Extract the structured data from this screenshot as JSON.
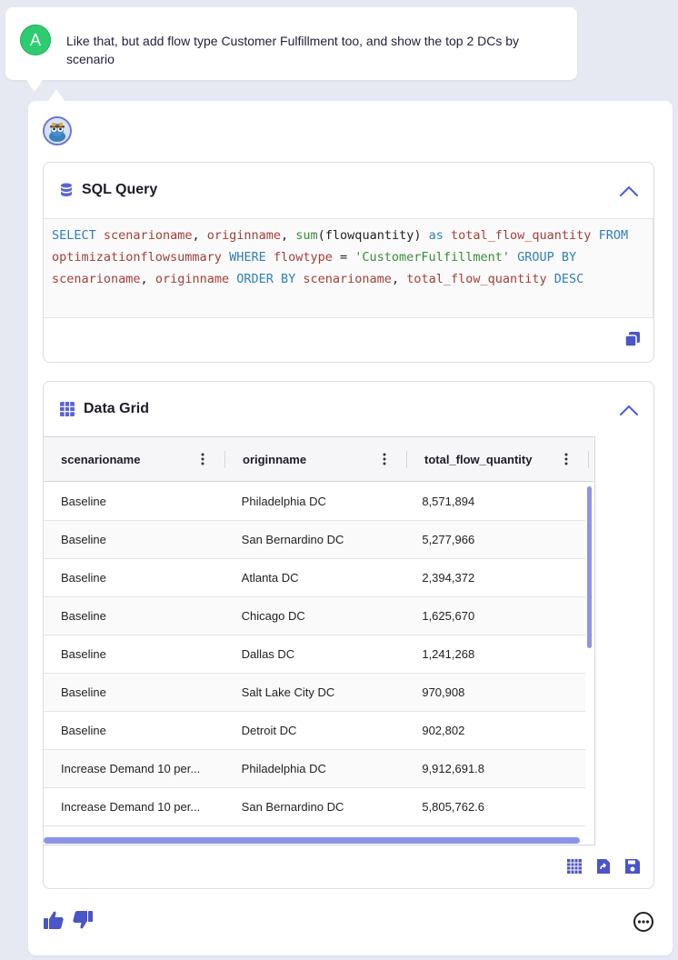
{
  "user_message": {
    "avatar_letter": "A",
    "text": "Like that, but add flow type Customer Fulfillment too, and show the top 2 DCs by scenario"
  },
  "sql_panel": {
    "title": "SQL Query",
    "query_tokens": [
      {
        "t": "SELECT",
        "c": "kw"
      },
      {
        "t": " "
      },
      {
        "t": "scenarioname",
        "c": "fn"
      },
      {
        "t": ", "
      },
      {
        "t": "originname",
        "c": "fn"
      },
      {
        "t": ", "
      },
      {
        "t": "sum",
        "c": "str"
      },
      {
        "t": "(flowquantity) "
      },
      {
        "t": "as",
        "c": "kw"
      },
      {
        "t": " "
      },
      {
        "t": "total_flow_quantity",
        "c": "fn"
      },
      {
        "t": " "
      },
      {
        "t": "FROM",
        "c": "kw"
      },
      {
        "t": " "
      },
      {
        "t": "optimizationflowsummary",
        "c": "fn"
      },
      {
        "t": " "
      },
      {
        "t": "WHERE",
        "c": "kw"
      },
      {
        "t": " "
      },
      {
        "t": "flowtype",
        "c": "fn"
      },
      {
        "t": " = "
      },
      {
        "t": "'CustomerFulfillment'",
        "c": "str"
      },
      {
        "t": " "
      },
      {
        "t": "GROUP BY",
        "c": "kw"
      },
      {
        "t": " "
      },
      {
        "t": "scenarioname",
        "c": "fn"
      },
      {
        "t": ", "
      },
      {
        "t": "originname",
        "c": "fn"
      },
      {
        "t": " "
      },
      {
        "t": "ORDER BY",
        "c": "kw"
      },
      {
        "t": " "
      },
      {
        "t": "scenarioname",
        "c": "fn"
      },
      {
        "t": ", "
      },
      {
        "t": "total_flow_quantity",
        "c": "fn"
      },
      {
        "t": " "
      },
      {
        "t": "DESC",
        "c": "kw"
      }
    ]
  },
  "grid_panel": {
    "title": "Data Grid",
    "columns": [
      "scenarioname",
      "originname",
      "total_flow_quantity"
    ],
    "rows": [
      [
        "Baseline",
        "Philadelphia DC",
        "8,571,894"
      ],
      [
        "Baseline",
        "San Bernardino DC",
        "5,277,966"
      ],
      [
        "Baseline",
        "Atlanta DC",
        "2,394,372"
      ],
      [
        "Baseline",
        "Chicago DC",
        "1,625,670"
      ],
      [
        "Baseline",
        "Dallas DC",
        "1,241,268"
      ],
      [
        "Baseline",
        "Salt Lake City DC",
        "970,908"
      ],
      [
        "Baseline",
        "Detroit DC",
        "902,802"
      ],
      [
        "Increase Demand 10 per...",
        "Philadelphia DC",
        "9,912,691.8"
      ],
      [
        "Increase Demand 10 per...",
        "San Bernardino DC",
        "5,805,762.6"
      ]
    ]
  },
  "icons": {
    "sql": "database-icon",
    "grid": "table-grid-icon",
    "copy": "copy-icon",
    "collapse": "chevron-up-icon",
    "tools": [
      "grid-view-icon",
      "export-file-icon",
      "save-icon"
    ],
    "feedback": [
      "thumbs-up-icon",
      "thumbs-down-icon"
    ],
    "more": "more-options-icon"
  },
  "colors": {
    "accent": "#5a64d6",
    "scrollbar": "#8f93e6",
    "user_avatar": "#2ecc71"
  }
}
